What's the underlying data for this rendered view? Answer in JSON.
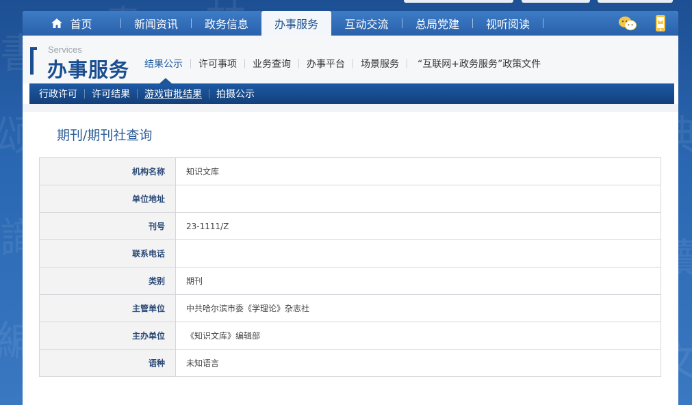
{
  "nav": {
    "items": [
      {
        "label": "首页",
        "active": false
      },
      {
        "label": "新闻资讯",
        "active": false
      },
      {
        "label": "政务信息",
        "active": false
      },
      {
        "label": "办事服务",
        "active": true
      },
      {
        "label": "互动交流",
        "active": false
      },
      {
        "label": "总局党建",
        "active": false
      },
      {
        "label": "视听阅读",
        "active": false
      }
    ],
    "icons": [
      "wechat-icon",
      "mobile-icon"
    ]
  },
  "section": {
    "en": "Services",
    "cn": "办事服务"
  },
  "subnav": [
    {
      "label": "结果公示",
      "active": true
    },
    {
      "label": "许可事项",
      "active": false
    },
    {
      "label": "业务查询",
      "active": false
    },
    {
      "label": "办事平台",
      "active": false
    },
    {
      "label": "场景服务",
      "active": false
    },
    {
      "label": "“互联网+政务服务”政策文件",
      "active": false
    }
  ],
  "tabs": [
    {
      "label": "行政许可",
      "active": false
    },
    {
      "label": "许可结果",
      "active": false
    },
    {
      "label": "游戏审批结果",
      "active": true
    },
    {
      "label": "拍摄公示",
      "active": false
    }
  ],
  "page_title": "期刊/期刊社查询",
  "rows": [
    {
      "label": "机构名称",
      "value": "知识文库"
    },
    {
      "label": "单位地址",
      "value": ""
    },
    {
      "label": "刊号",
      "value": "23-1111/Z"
    },
    {
      "label": "联系电话",
      "value": ""
    },
    {
      "label": "类别",
      "value": "期刊"
    },
    {
      "label": "主管单位",
      "value": "中共哈尔滨市委《学理论》杂志社"
    },
    {
      "label": "主办单位",
      "value": "《知识文库》编辑部"
    },
    {
      "label": "语种",
      "value": "未知语言"
    }
  ],
  "colors": {
    "brand_blue": "#1a4e90",
    "nav_blue": "#2a61ab",
    "tab_bar": "#143f7a",
    "label_text": "#2b4a78"
  }
}
